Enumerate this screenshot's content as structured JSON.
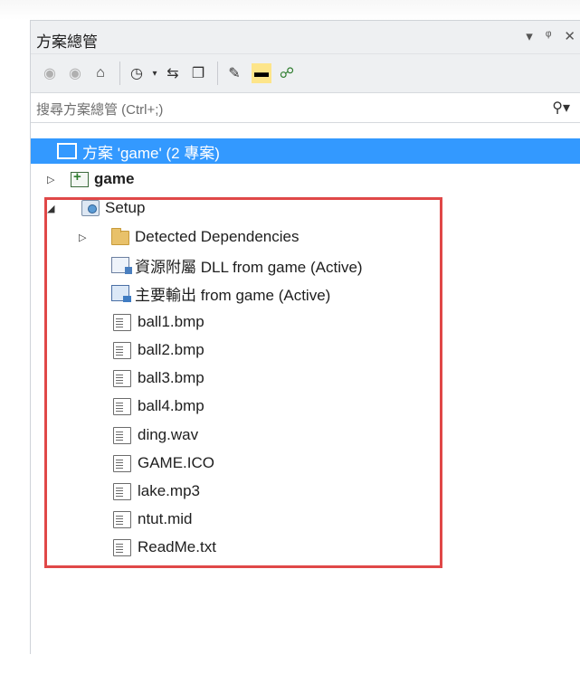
{
  "panel": {
    "title": "方案總管",
    "title_buttons": [
      "▾",
      "ᵠ",
      "✕"
    ]
  },
  "toolbar": {
    "icons": [
      "back-icon",
      "forward-icon",
      "home-icon",
      "history-icon",
      "sync-icon",
      "collapse-icon",
      "properties-icon",
      "preview-icon",
      "diagram-icon"
    ]
  },
  "search": {
    "placeholder": "搜尋方案總管 (Ctrl+;)"
  },
  "tree": {
    "solution": "方案 'game' (2 專案)",
    "project_game": "game",
    "project_setup": "Setup",
    "items": [
      "Detected Dependencies",
      "資源附屬 DLL from game (Active)",
      "主要輸出 from game (Active)",
      "ball1.bmp",
      "ball2.bmp",
      "ball3.bmp",
      "ball4.bmp",
      "ding.wav",
      "GAME.ICO",
      "lake.mp3",
      "ntut.mid",
      "ReadMe.txt"
    ]
  },
  "colors": {
    "selection": "#3399ff",
    "highlight_box": "#e04848"
  }
}
